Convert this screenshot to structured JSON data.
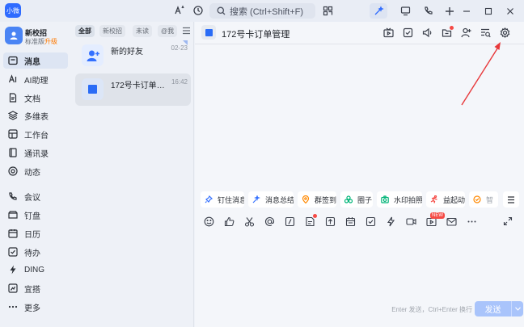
{
  "titlebar": {
    "app_badge": "小微",
    "search_placeholder": "搜索 (Ctrl+Shift+F)"
  },
  "profile": {
    "name": "新校招",
    "edition": "标准版",
    "upgrade": "升级"
  },
  "sidebar": {
    "items": [
      {
        "label": "消息",
        "icon": "message-icon",
        "active": true
      },
      {
        "label": "AI助理",
        "icon": "ai-assistant-icon"
      },
      {
        "label": "文档",
        "icon": "document-icon"
      },
      {
        "label": "多维表",
        "icon": "multidim-table-icon"
      },
      {
        "label": "工作台",
        "icon": "workbench-icon"
      },
      {
        "label": "通讯录",
        "icon": "contacts-icon"
      },
      {
        "label": "动态",
        "icon": "activity-icon"
      },
      {
        "label": "会议",
        "icon": "meeting-icon"
      },
      {
        "label": "钉盘",
        "icon": "drive-icon"
      },
      {
        "label": "日历",
        "icon": "calendar-icon"
      },
      {
        "label": "待办",
        "icon": "todo-icon"
      },
      {
        "label": "DING",
        "icon": "ding-icon"
      },
      {
        "label": "宜搭",
        "icon": "yida-icon"
      },
      {
        "label": "更多",
        "icon": "more-icon"
      }
    ]
  },
  "filters": {
    "all": "全部",
    "group": "新校招",
    "unread": "未读",
    "mention": "@我"
  },
  "conversations": [
    {
      "name": "新的好友",
      "time": "02-23"
    },
    {
      "name": "172号卡订单管理",
      "time": "16:42"
    }
  ],
  "chat": {
    "title": "172号卡订单管理"
  },
  "quick_actions": [
    {
      "label": "钉住消息",
      "icon": "pin-icon",
      "color": "#3370ff"
    },
    {
      "label": "消息总结",
      "icon": "summary-icon",
      "color": "#3370ff"
    },
    {
      "label": "群签到",
      "icon": "checkin-icon",
      "color": "#ff8800"
    },
    {
      "label": "圈子",
      "icon": "circle-icon",
      "color": "#00b578"
    },
    {
      "label": "水印拍照",
      "icon": "camera-icon",
      "color": "#00b578"
    },
    {
      "label": "益起动",
      "icon": "run-icon",
      "color": "#f54a45"
    },
    {
      "label": "智",
      "icon": "smart-icon",
      "color": "#ff8800"
    }
  ],
  "composer": {
    "new_badge": "NEW",
    "hint": "Enter 发送，Ctrl+Enter 换行",
    "send_label": "发送"
  },
  "colors": {
    "accent": "#2f6bff",
    "send_disabled": "#a9c4fb",
    "badge_red": "#f54a45",
    "annotation_arrow": "#e8383a"
  }
}
